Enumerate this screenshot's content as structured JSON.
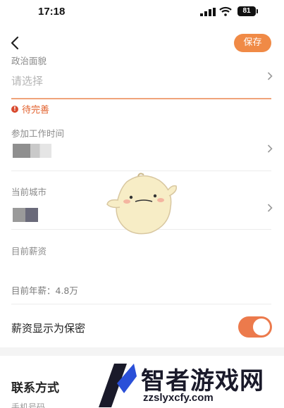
{
  "status_bar": {
    "time": "17:18",
    "battery": "81"
  },
  "header": {
    "save_label": "保存"
  },
  "fields": {
    "political": {
      "label": "政治面貌",
      "placeholder": "请选择",
      "warning": "待完善"
    },
    "work_start": {
      "label": "参加工作时间"
    },
    "city": {
      "label": "当前城市"
    },
    "salary": {
      "label": "目前薪资",
      "annual": "目前年薪：4.8万"
    }
  },
  "privacy": {
    "label": "薪资显示为保密",
    "toggle_on": true
  },
  "contact": {
    "title": "联系方式",
    "sub_label": "手机号码"
  },
  "watermark": {
    "brand": "智者游戏网",
    "url": "zzslyxcfy.com"
  },
  "colors": {
    "accent": "#f08a46",
    "warning": "#e2612d",
    "toggle": "#ec7a4c"
  }
}
